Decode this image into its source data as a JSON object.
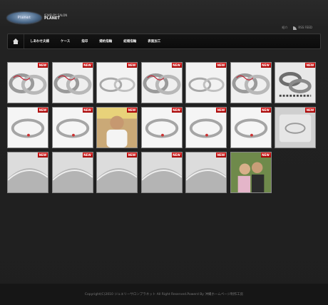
{
  "header": {
    "logo_text": "Planet",
    "logo_sub_line1": "JEWELRY SALON",
    "logo_sub_line2": "PLANET",
    "util_link": "紹介",
    "rss_label": "RSS FEED"
  },
  "nav": {
    "items": [
      "しあわせ夫婦",
      "ケース",
      "指印",
      "婚約指輪",
      "結婚指輪",
      "表面加工"
    ]
  },
  "thumbnails": {
    "badge": "NEW",
    "items": [
      {
        "kind": "rings-pair-pattern",
        "new": true
      },
      {
        "kind": "rings-pair-pattern",
        "new": true
      },
      {
        "kind": "rings-pair-plain",
        "new": true
      },
      {
        "kind": "rings-pair-pattern",
        "new": true
      },
      {
        "kind": "rings-pair-plain",
        "new": true
      },
      {
        "kind": "rings-pair-pattern",
        "new": true
      },
      {
        "kind": "rings-stack",
        "new": true
      },
      {
        "kind": "ring-single",
        "new": true
      },
      {
        "kind": "ring-single",
        "new": true
      },
      {
        "kind": "person",
        "new": true
      },
      {
        "kind": "ring-single",
        "new": true
      },
      {
        "kind": "ring-single",
        "new": true
      },
      {
        "kind": "ring-single",
        "new": true
      },
      {
        "kind": "ring-box",
        "new": true
      },
      {
        "kind": "ring-closeup",
        "new": true
      },
      {
        "kind": "ring-closeup",
        "new": true
      },
      {
        "kind": "ring-closeup",
        "new": true
      },
      {
        "kind": "ring-closeup",
        "new": true
      },
      {
        "kind": "ring-closeup",
        "new": true
      },
      {
        "kind": "couple",
        "new": true
      }
    ]
  },
  "footer": {
    "copyright": "Copyright(C)2010 ジュエリーサロンプラネット All Right Reserved.Powerd By 沖縄ホームページ制作工房"
  }
}
